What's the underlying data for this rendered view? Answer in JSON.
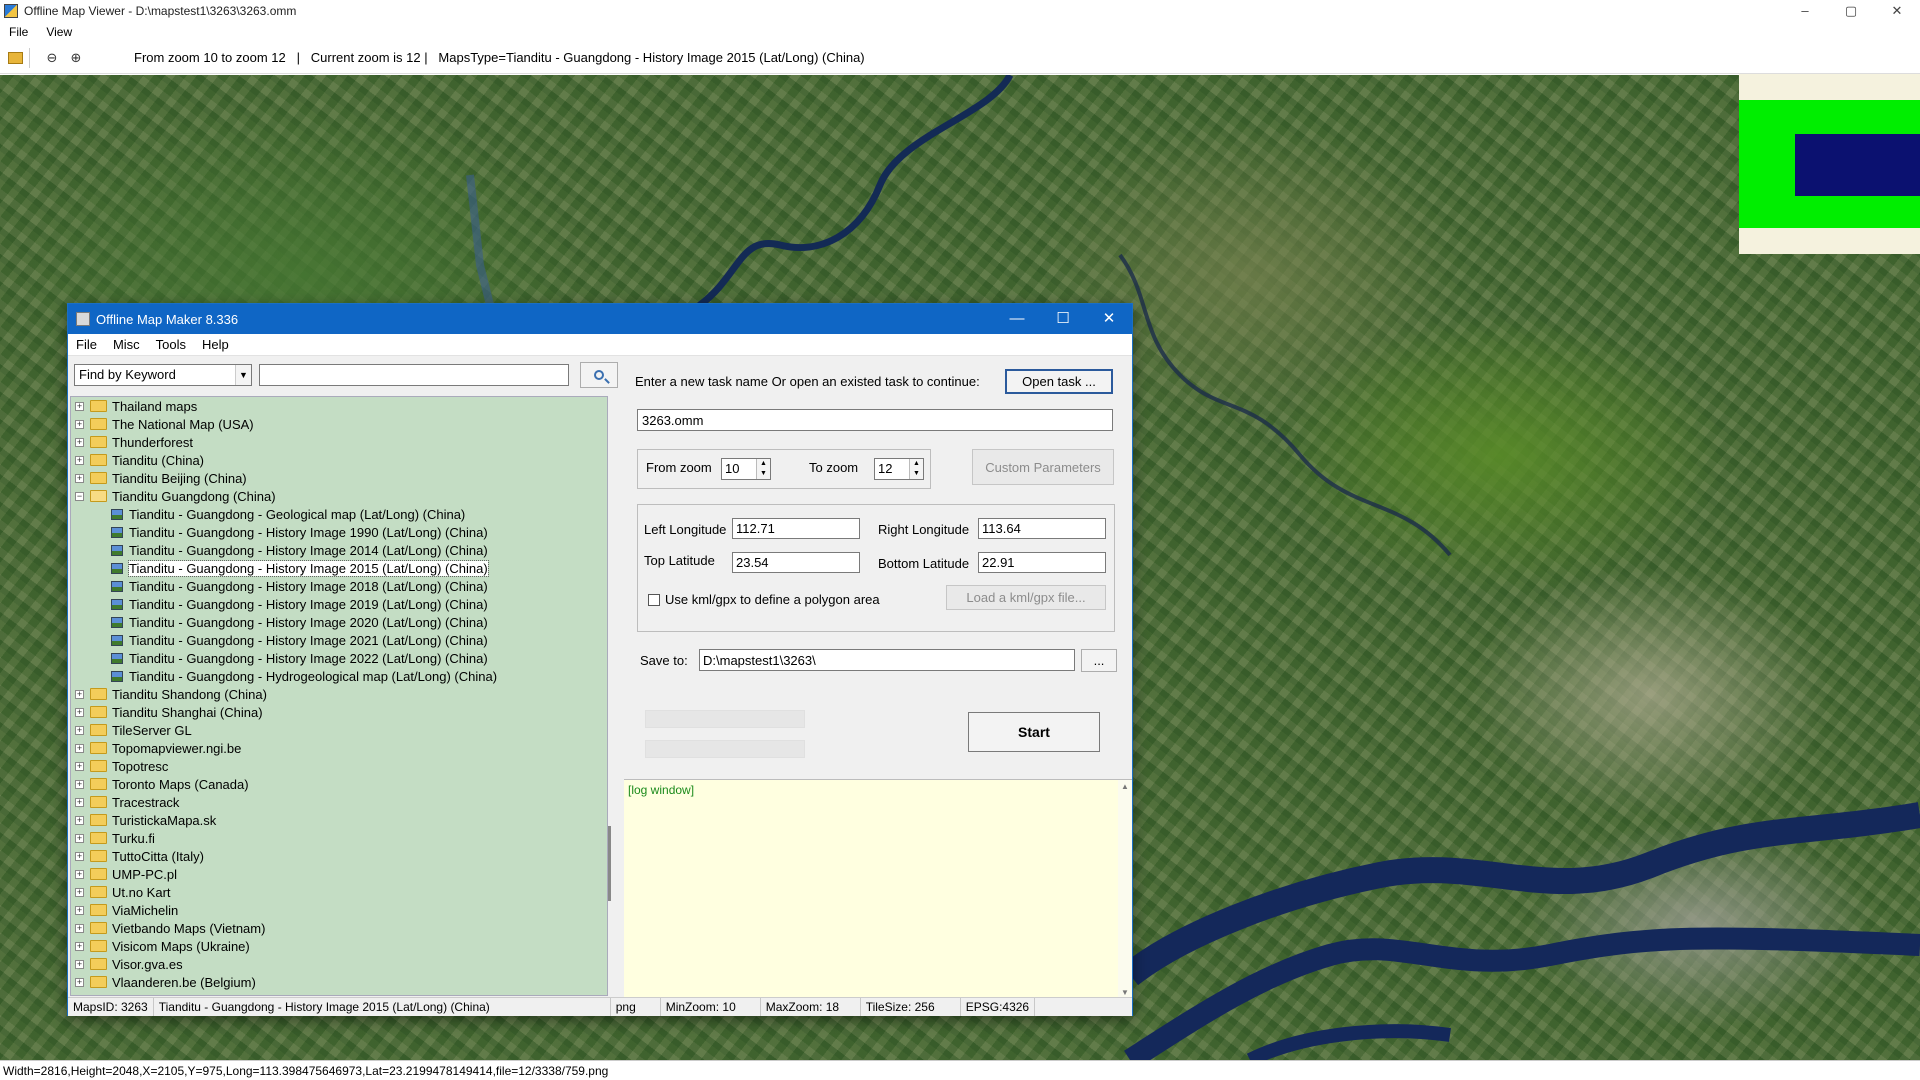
{
  "viewer": {
    "title": "Offline Map Viewer - D:\\mapstest1\\3263\\3263.omm",
    "window_controls": [
      "–",
      "▢",
      "✕"
    ],
    "menu": [
      "File",
      "View"
    ],
    "toolbar": {
      "zoom_info": "From zoom 10 to zoom 12   |   Current zoom is 12 |   MapsType=Tianditu - Guangdong - History Image 2015 (Lat/Long) (China)"
    },
    "status": "Width=2816,Height=2048,X=2105,Y=975,Long=113.398475646973,Lat=23.2199478149414,file=12/3338/759.png"
  },
  "maker": {
    "title": "Offline Map Maker 8.336",
    "window_controls": [
      "—",
      "☐",
      "✕"
    ],
    "menu": [
      "File",
      "Misc",
      "Tools",
      "Help"
    ],
    "find_mode": "Find by Keyword",
    "find_value": "",
    "tree": [
      {
        "label": "Thailand maps",
        "level": 0,
        "expander": "+"
      },
      {
        "label": "The National Map (USA)",
        "level": 0,
        "expander": "+"
      },
      {
        "label": "Thunderforest",
        "level": 0,
        "expander": "+"
      },
      {
        "label": "Tianditu (China)",
        "level": 0,
        "expander": "+"
      },
      {
        "label": "Tianditu Beijing (China)",
        "level": 0,
        "expander": "+"
      },
      {
        "label": "Tianditu Guangdong (China)",
        "level": 0,
        "expander": "−",
        "open": true
      },
      {
        "label": "Tianditu - Guangdong - Geological map (Lat/Long) (China)",
        "level": 1
      },
      {
        "label": "Tianditu - Guangdong - History Image 1990 (Lat/Long) (China)",
        "level": 1
      },
      {
        "label": "Tianditu - Guangdong - History Image 2014 (Lat/Long) (China)",
        "level": 1
      },
      {
        "label": "Tianditu - Guangdong - History Image 2015 (Lat/Long) (China)",
        "level": 1,
        "selected": true
      },
      {
        "label": "Tianditu - Guangdong - History Image 2018 (Lat/Long) (China)",
        "level": 1
      },
      {
        "label": "Tianditu - Guangdong - History Image 2019 (Lat/Long) (China)",
        "level": 1
      },
      {
        "label": "Tianditu - Guangdong - History Image 2020 (Lat/Long) (China)",
        "level": 1
      },
      {
        "label": "Tianditu - Guangdong - History Image 2021 (Lat/Long) (China)",
        "level": 1
      },
      {
        "label": "Tianditu - Guangdong - History Image 2022 (Lat/Long) (China)",
        "level": 1
      },
      {
        "label": "Tianditu - Guangdong - Hydrogeological map (Lat/Long) (China)",
        "level": 1
      },
      {
        "label": "Tianditu Shandong (China)",
        "level": 0,
        "expander": "+"
      },
      {
        "label": "Tianditu Shanghai (China)",
        "level": 0,
        "expander": "+"
      },
      {
        "label": "TileServer GL",
        "level": 0,
        "expander": "+"
      },
      {
        "label": "Topomapviewer.ngi.be",
        "level": 0,
        "expander": "+"
      },
      {
        "label": "Topotresc",
        "level": 0,
        "expander": "+"
      },
      {
        "label": "Toronto Maps (Canada)",
        "level": 0,
        "expander": "+"
      },
      {
        "label": "Tracestrack",
        "level": 0,
        "expander": "+"
      },
      {
        "label": "TuristickaMapa.sk",
        "level": 0,
        "expander": "+"
      },
      {
        "label": "Turku.fi",
        "level": 0,
        "expander": "+"
      },
      {
        "label": "TuttoCitta (Italy)",
        "level": 0,
        "expander": "+"
      },
      {
        "label": "UMP-PC.pl",
        "level": 0,
        "expander": "+"
      },
      {
        "label": "Ut.no Kart",
        "level": 0,
        "expander": "+"
      },
      {
        "label": "ViaMichelin",
        "level": 0,
        "expander": "+"
      },
      {
        "label": "Vietbando Maps (Vietnam)",
        "level": 0,
        "expander": "+"
      },
      {
        "label": "Visicom Maps (Ukraine)",
        "level": 0,
        "expander": "+"
      },
      {
        "label": "Visor.gva.es",
        "level": 0,
        "expander": "+"
      },
      {
        "label": "Vlaanderen.be (Belgium)",
        "level": 0,
        "expander": "+"
      }
    ],
    "task_prompt": "Enter a new task name Or open an existed task to continue:",
    "open_task_label": "Open task ...",
    "task_name": "3263.omm",
    "from_zoom_label": "From zoom",
    "from_zoom": "10",
    "to_zoom_label": "To zoom",
    "to_zoom": "12",
    "custom_params_label": "Custom Parameters",
    "left_lon_label": "Left Longitude",
    "left_lon": "112.71",
    "right_lon_label": "Right Longitude",
    "right_lon": "113.64",
    "top_lat_label": "Top Latitude",
    "top_lat": "23.54",
    "bottom_lat_label": "Bottom Latitude",
    "bottom_lat": "22.91",
    "kml_label": "Use kml/gpx to define a polygon area",
    "load_kml_label": "Load a kml/gpx file...",
    "save_label": "Save to:",
    "save_path": "D:\\mapstest1\\3263\\",
    "browse_label": "...",
    "start_label": "Start",
    "log_text": "[log window]",
    "status": {
      "maps_id": "MapsID: 3263",
      "map_name": "Tianditu - Guangdong - History Image 2015 (Lat/Long) (China)",
      "format": "png",
      "min_zoom": "MinZoom: 10",
      "max_zoom": "MaxZoom: 18",
      "tile_size": "TileSize: 256",
      "epsg": "EPSG:4326"
    }
  },
  "colors": {
    "dialog_title_bg": "#0f66c5",
    "tree_bg": "#c4ddc4",
    "log_bg": "#ffffe0",
    "minimap_green": "#00ee00",
    "minimap_navy": "#0b1170"
  }
}
